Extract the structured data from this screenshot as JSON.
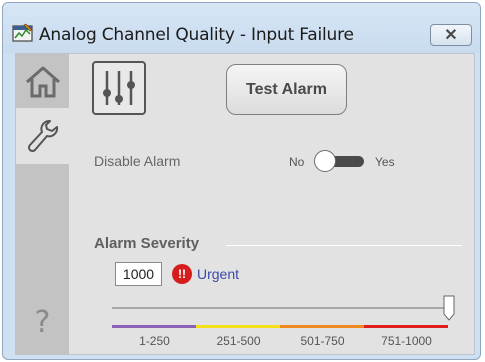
{
  "window": {
    "title": "Analog Channel Quality - Input Failure",
    "close_label": "✕"
  },
  "nav": {
    "home_icon": "home-icon",
    "tools_icon": "wrench-icon",
    "help_label": "?"
  },
  "toolbar": {
    "settings_icon": "sliders-icon",
    "test_alarm_label": "Test Alarm"
  },
  "disable_alarm": {
    "label": "Disable Alarm",
    "off_label": "No",
    "on_label": "Yes",
    "state": "No"
  },
  "severity": {
    "title": "Alarm Severity",
    "value": "1000",
    "level_label": "Urgent",
    "level_icon": "!!",
    "slider_fraction": 1.0,
    "bands": [
      {
        "label": "1-250",
        "color": "#8b62b8"
      },
      {
        "label": "251-500",
        "color": "#f4e11a"
      },
      {
        "label": "501-750",
        "color": "#f08a20"
      },
      {
        "label": "751-1000",
        "color": "#e01e1e"
      }
    ]
  },
  "colors": {
    "urgent": "#d61d1d",
    "urgent_text": "#3a4aa8"
  }
}
